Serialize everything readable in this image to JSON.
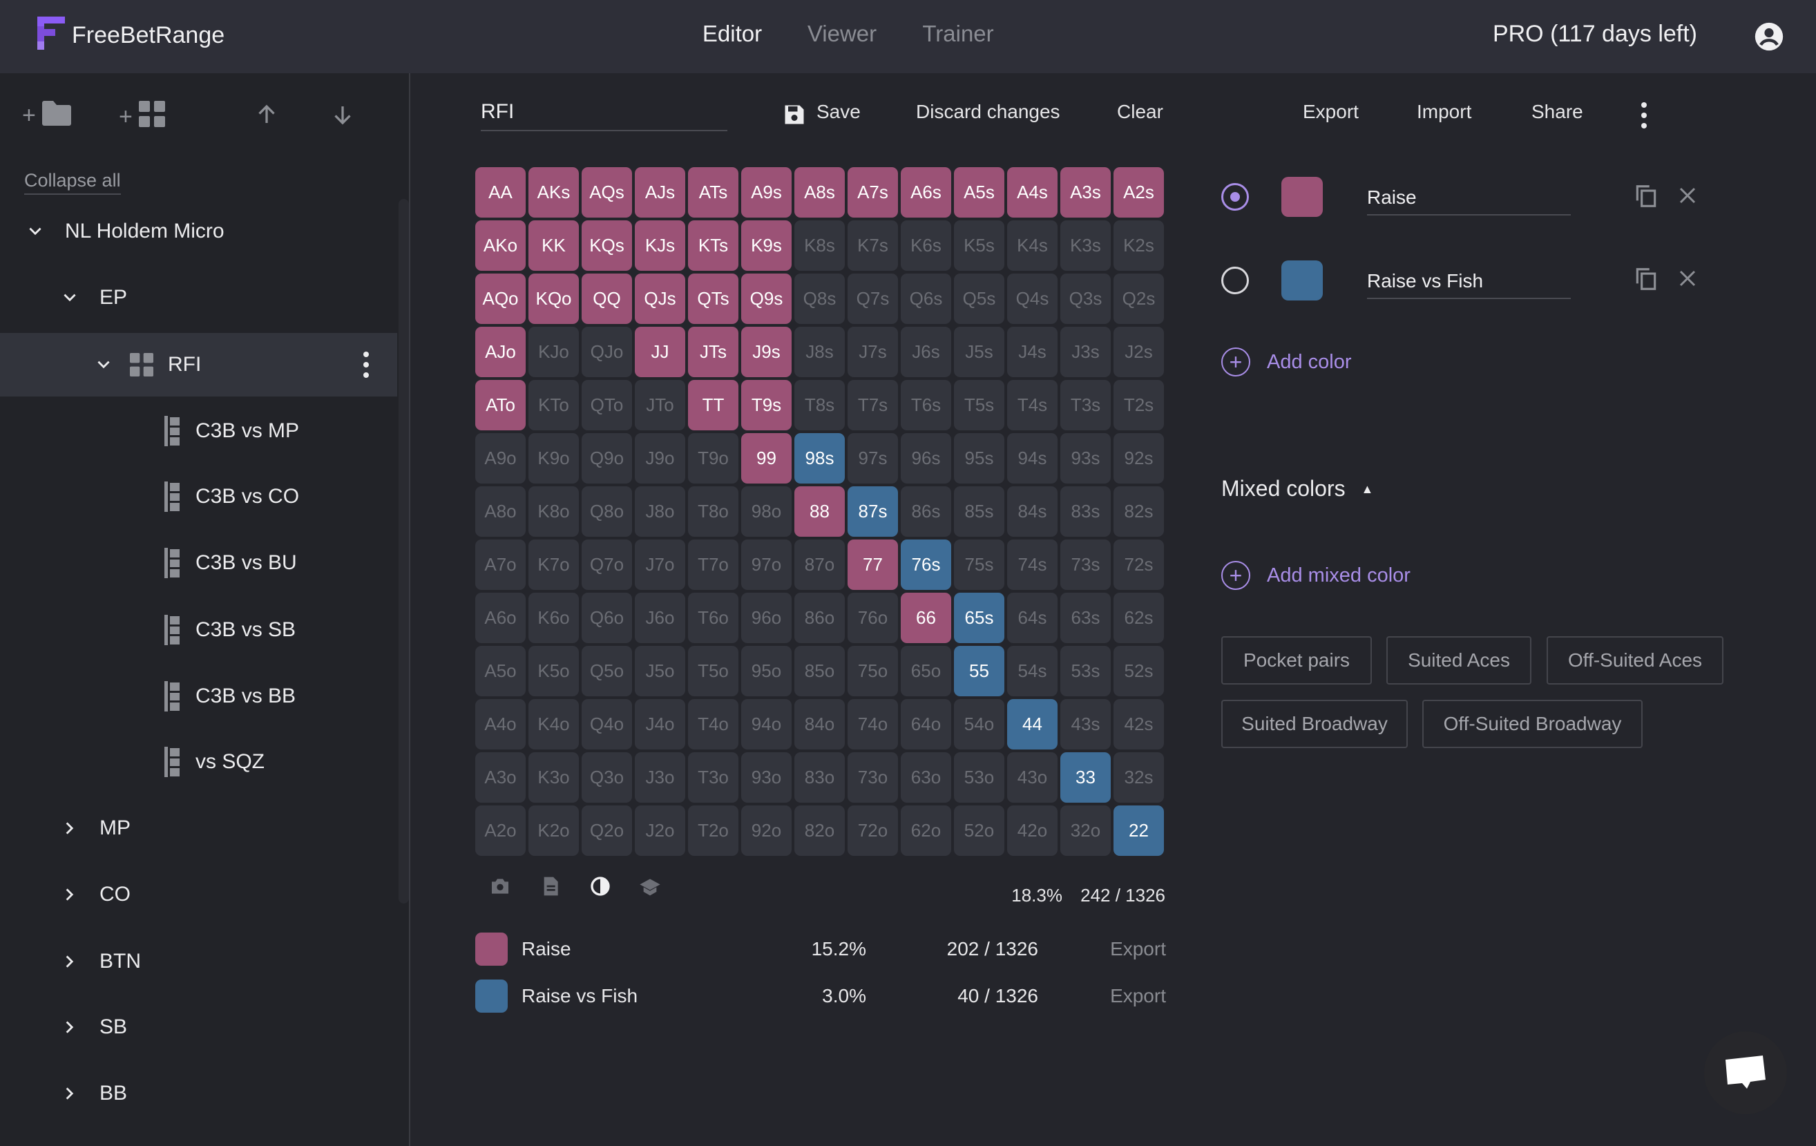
{
  "header": {
    "app_name": "FreeBetRange",
    "nav": [
      {
        "label": "Editor",
        "active": true
      },
      {
        "label": "Viewer"
      },
      {
        "label": "Trainer"
      }
    ],
    "subscription": "PRO (117 days left)"
  },
  "sidebar": {
    "collapse_all": "Collapse all",
    "tree": {
      "root": "NL Holdem Micro",
      "ep": "EP",
      "selected": "RFI",
      "children": [
        "C3B vs MP",
        "C3B vs CO",
        "C3B vs BU",
        "C3B vs SB",
        "C3B vs BB",
        "vs SQZ"
      ],
      "positions": [
        "MP",
        "CO",
        "BTN",
        "SB",
        "BB"
      ]
    }
  },
  "toolbar": {
    "range_name": "RFI",
    "save": "Save",
    "discard": "Discard changes",
    "clear": "Clear",
    "export": "Export",
    "import": "Import",
    "share": "Share"
  },
  "colors": {
    "raise": "#9b5276",
    "raise_vs_fish": "#3e6d97",
    "accent": "#a98ee8"
  },
  "grid": {
    "rows": [
      [
        "AA",
        "AKs",
        "AQs",
        "AJs",
        "ATs",
        "A9s",
        "A8s",
        "A7s",
        "A6s",
        "A5s",
        "A4s",
        "A3s",
        "A2s"
      ],
      [
        "AKo",
        "KK",
        "KQs",
        "KJs",
        "KTs",
        "K9s",
        "K8s",
        "K7s",
        "K6s",
        "K5s",
        "K4s",
        "K3s",
        "K2s"
      ],
      [
        "AQo",
        "KQo",
        "QQ",
        "QJs",
        "QTs",
        "Q9s",
        "Q8s",
        "Q7s",
        "Q6s",
        "Q5s",
        "Q4s",
        "Q3s",
        "Q2s"
      ],
      [
        "AJo",
        "KJo",
        "QJo",
        "JJ",
        "JTs",
        "J9s",
        "J8s",
        "J7s",
        "J6s",
        "J5s",
        "J4s",
        "J3s",
        "J2s"
      ],
      [
        "ATo",
        "KTo",
        "QTo",
        "JTo",
        "TT",
        "T9s",
        "T8s",
        "T7s",
        "T6s",
        "T5s",
        "T4s",
        "T3s",
        "T2s"
      ],
      [
        "A9o",
        "K9o",
        "Q9o",
        "J9o",
        "T9o",
        "99",
        "98s",
        "97s",
        "96s",
        "95s",
        "94s",
        "93s",
        "92s"
      ],
      [
        "A8o",
        "K8o",
        "Q8o",
        "J8o",
        "T8o",
        "98o",
        "88",
        "87s",
        "86s",
        "85s",
        "84s",
        "83s",
        "82s"
      ],
      [
        "A7o",
        "K7o",
        "Q7o",
        "J7o",
        "T7o",
        "97o",
        "87o",
        "77",
        "76s",
        "75s",
        "74s",
        "73s",
        "72s"
      ],
      [
        "A6o",
        "K6o",
        "Q6o",
        "J6o",
        "T6o",
        "96o",
        "86o",
        "76o",
        "66",
        "65s",
        "64s",
        "63s",
        "62s"
      ],
      [
        "A5o",
        "K5o",
        "Q5o",
        "J5o",
        "T5o",
        "95o",
        "85o",
        "75o",
        "65o",
        "55",
        "54s",
        "53s",
        "52s"
      ],
      [
        "A4o",
        "K4o",
        "Q4o",
        "J4o",
        "T4o",
        "94o",
        "84o",
        "74o",
        "64o",
        "54o",
        "44",
        "43s",
        "42s"
      ],
      [
        "A3o",
        "K3o",
        "Q3o",
        "J3o",
        "T3o",
        "93o",
        "83o",
        "73o",
        "63o",
        "53o",
        "43o",
        "33",
        "32s"
      ],
      [
        "A2o",
        "K2o",
        "Q2o",
        "J2o",
        "T2o",
        "92o",
        "82o",
        "72o",
        "62o",
        "52o",
        "42o",
        "32o",
        "22"
      ]
    ],
    "raise": [
      "AA",
      "AKs",
      "AQs",
      "AJs",
      "ATs",
      "A9s",
      "A8s",
      "A7s",
      "A6s",
      "A5s",
      "A4s",
      "A3s",
      "A2s",
      "AKo",
      "KK",
      "KQs",
      "KJs",
      "KTs",
      "K9s",
      "AQo",
      "KQo",
      "QQ",
      "QJs",
      "QTs",
      "Q9s",
      "AJo",
      "JJ",
      "JTs",
      "J9s",
      "ATo",
      "TT",
      "T9s",
      "99",
      "88",
      "77",
      "66"
    ],
    "raise_vs_fish": [
      "98s",
      "87s",
      "76s",
      "65s",
      "55",
      "44",
      "33",
      "22"
    ]
  },
  "summary": {
    "percent": "18.3%",
    "combos": "242 / 1326"
  },
  "legend": [
    {
      "name": "Raise",
      "percent": "15.2%",
      "combos": "202 / 1326",
      "export": "Export"
    },
    {
      "name": "Raise vs Fish",
      "percent": "3.0%",
      "combos": "40 / 1326",
      "export": "Export"
    }
  ],
  "color_list": [
    {
      "name": "Raise",
      "selected": true
    },
    {
      "name": "Raise vs Fish",
      "selected": false
    }
  ],
  "add_color": "Add color",
  "mixed_colors": "Mixed colors",
  "add_mixed_color": "Add mixed color",
  "presets": [
    "Pocket pairs",
    "Suited Aces",
    "Off-Suited Aces",
    "Suited Broadway",
    "Off-Suited Broadway"
  ]
}
